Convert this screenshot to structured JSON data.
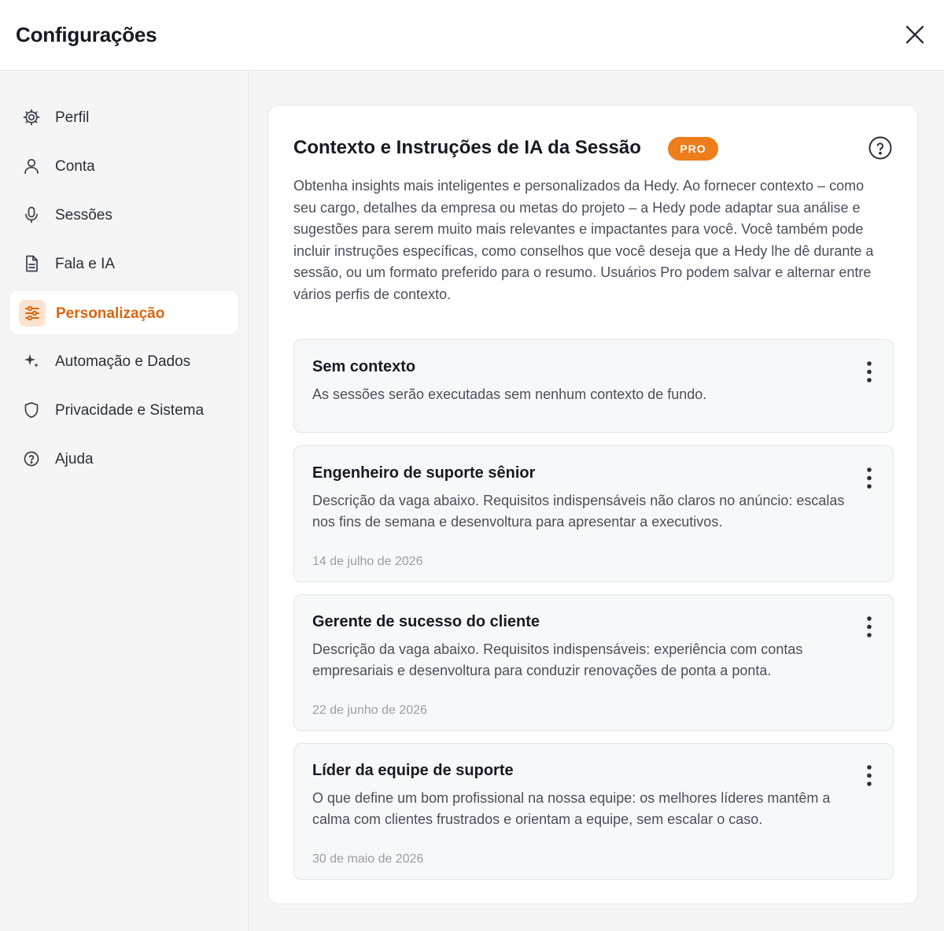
{
  "window": {
    "title": "Configurações",
    "close_icon": "close-icon"
  },
  "sidebar": {
    "items": [
      {
        "label": "Perfil",
        "icon": "gear-icon"
      },
      {
        "label": "Conta",
        "icon": "user-icon"
      },
      {
        "label": "Sessões",
        "icon": "microphone-icon"
      },
      {
        "label": "Fala e IA",
        "icon": "document-icon"
      },
      {
        "label": "Personalização",
        "icon": "sliders-icon",
        "active": true
      },
      {
        "label": "Automação e Dados",
        "icon": "sparkles-icon"
      },
      {
        "label": "Privacidade e Sistema",
        "icon": "shield-icon"
      },
      {
        "label": "Ajuda",
        "icon": "help-icon"
      }
    ]
  },
  "main": {
    "title": "Contexto e Instruções de IA da Sessão",
    "badge": "PRO",
    "help_icon": "help-circle-icon",
    "description": "Obtenha insights mais inteligentes e personalizados da Hedy. Ao fornecer contexto – como seu cargo, detalhes da empresa ou metas do projeto – a Hedy pode adaptar sua análise e sugestões para serem muito mais relevantes e impactantes para você. Você também pode incluir instruções específicas, como conselhos que você deseja que a Hedy lhe dê durante a sessão, ou um formato preferido para o resumo. Usuários Pro podem salvar e alternar entre vários perfis de contexto.",
    "contexts": [
      {
        "title": "Sem contexto",
        "description": "As sessões serão executadas sem nenhum contexto de fundo.",
        "date": ""
      },
      {
        "title": "Engenheiro de suporte sênior",
        "description": "Descrição da vaga abaixo. Requisitos indispensáveis não claros no anúncio: escalas nos fins de semana e desenvoltura para apresentar a executivos.",
        "date": "14 de julho de 2026"
      },
      {
        "title": "Gerente de sucesso do cliente",
        "description": "Descrição da vaga abaixo. Requisitos indispensáveis: experiência com contas empresariais e desenvoltura para conduzir renovações de ponta a ponta.",
        "date": "22 de junho de 2026"
      },
      {
        "title": "Líder da equipe de suporte",
        "description": "O que define um bom profissional na nossa equipe: os melhores líderes mantêm a calma com clientes frustrados e orientam a equipe, sem escalar o caso.",
        "date": "30 de maio de 2026"
      }
    ]
  },
  "colors": {
    "accent": "#ee7d1b",
    "accent_text": "#d9650f",
    "active_icon_bg": "#fde3cf",
    "sidebar_bg": "#f5f5f5",
    "card_bg": "#f7f8fa"
  }
}
